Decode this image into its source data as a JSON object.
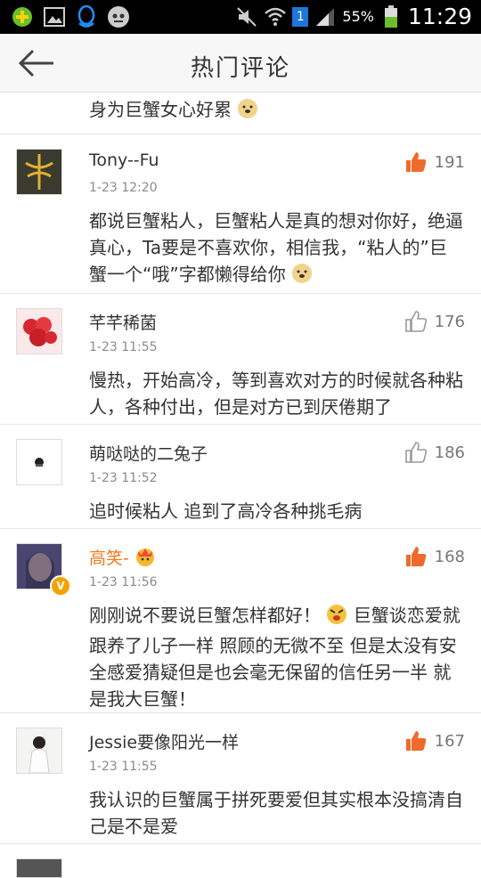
{
  "status_bar": {
    "sim_index": "1",
    "battery_percent": "55%",
    "time": "11:29"
  },
  "header": {
    "title": "热门评论"
  },
  "partial_comment": {
    "text": "身为巨蟹女心好累"
  },
  "comments": [
    {
      "username": "Tony--Fu",
      "time": "1-23 12:20",
      "likes": "191",
      "liked": true,
      "text": "都说巨蟹粘人，巨蟹粘人是真的想对你好，绝逼真心，Ta要是不喜欢你，相信我，“粘人的”巨蟹一个“哦”字都懒得给你"
    },
    {
      "username": "芊芊稀菌",
      "time": "1-23 11:55",
      "likes": "176",
      "liked": false,
      "text": "慢热，开始高冷，等到喜欢对方的时候就各种粘人，各种付出，但是对方已到厌倦期了"
    },
    {
      "username": "萌哒哒的二兔子",
      "time": "1-23 11:52",
      "likes": "186",
      "liked": false,
      "text": "追时候粘人 追到了高冷各种挑毛病"
    },
    {
      "username": "高笑-",
      "time": "1-23 11:56",
      "likes": "168",
      "liked": true,
      "text_before_emoji": "刚刚说不要说巨蟹怎样都好！",
      "text": "巨蟹谈恋爱就跟养了儿子一样 照顾的无微不至 但是太没有安全感爱猜疑但是也会毫无保留的信任另一半 就是我大巨蟹！"
    },
    {
      "username": "Jessie要像阳光一样",
      "time": "1-23 11:55",
      "likes": "167",
      "liked": true,
      "text": "我认识的巨蟹属于拼死要爱但其实根本没搞清自己是不是爱"
    }
  ],
  "colors": {
    "liked_thumb": "#f06a2c",
    "unliked_thumb": "#999999",
    "vip_name": "#ef7a1e"
  }
}
